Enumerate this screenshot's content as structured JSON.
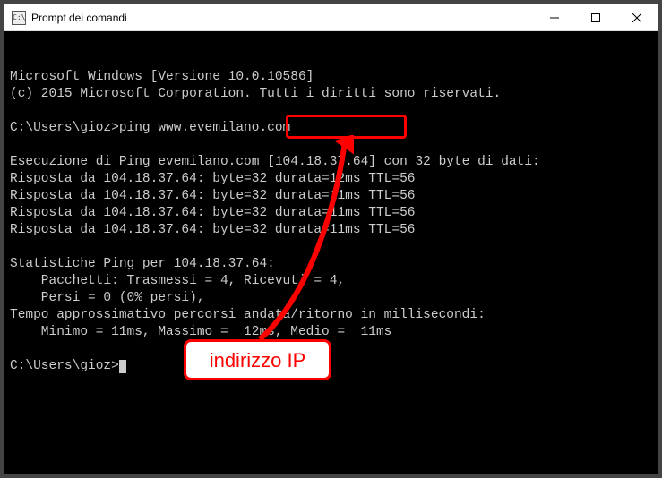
{
  "window": {
    "title": "Prompt dei comandi",
    "icon_text": "C:\\"
  },
  "terminal": {
    "line1": "Microsoft Windows [Versione 10.0.10586]",
    "line2": "(c) 2015 Microsoft Corporation. Tutti i diritti sono riservati.",
    "blank1": "",
    "prompt1_prefix": "C:\\Users\\gioz>",
    "prompt1_cmd": "ping www.evemilano.com",
    "blank2": "",
    "exec_line": "Esecuzione di Ping evemilano.com [104.18.37.64] con 32 byte di dati:",
    "reply1": "Risposta da 104.18.37.64: byte=32 durata=12ms TTL=56",
    "reply2": "Risposta da 104.18.37.64: byte=32 durata=11ms TTL=56",
    "reply3": "Risposta da 104.18.37.64: byte=32 durata=11ms TTL=56",
    "reply4": "Risposta da 104.18.37.64: byte=32 durata=11ms TTL=56",
    "blank3": "",
    "stats_header": "Statistiche Ping per 104.18.37.64:",
    "stats_packets": "    Pacchetti: Trasmessi = 4, Ricevuti = 4,",
    "stats_loss": "    Persi = 0 (0% persi),",
    "rtt_header": "Tempo approssimativo percorsi andata/ritorno in millisecondi:",
    "rtt_values": "    Minimo = 11ms, Massimo =  12ms, Medio =  11ms",
    "blank4": "",
    "prompt2_prefix": "C:\\Users\\gioz>"
  },
  "annotation": {
    "label": "indirizzo IP",
    "highlighted_ip": "104.18.37.64"
  },
  "controls": {
    "minimize": "minimize",
    "maximize": "maximize",
    "close": "close"
  }
}
